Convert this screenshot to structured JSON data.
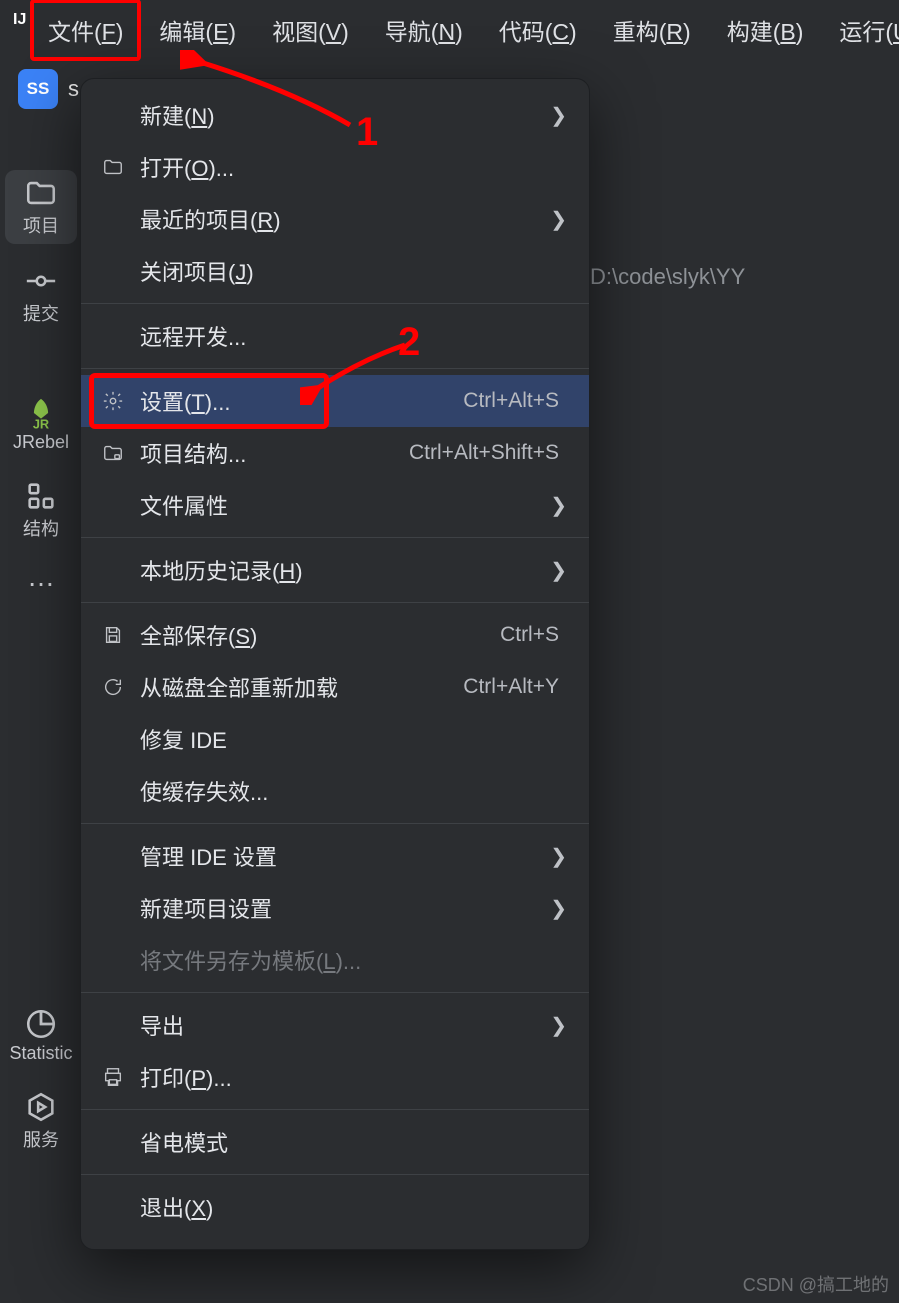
{
  "menubar": {
    "items": [
      {
        "pre": "文件(",
        "mn": "F",
        "post": ")"
      },
      {
        "pre": "编辑(",
        "mn": "E",
        "post": ")"
      },
      {
        "pre": "视图(",
        "mn": "V",
        "post": ")"
      },
      {
        "pre": "导航(",
        "mn": "N",
        "post": ")"
      },
      {
        "pre": "代码(",
        "mn": "C",
        "post": ")"
      },
      {
        "pre": "重构(",
        "mn": "R",
        "post": ")"
      },
      {
        "pre": "构建(",
        "mn": "B",
        "post": ")"
      },
      {
        "pre": "运行(",
        "mn": "U",
        "post": ""
      }
    ]
  },
  "breadcrumb": {
    "badge": "SS",
    "text": "s"
  },
  "leftbar": {
    "project": "项目",
    "commit": "提交",
    "jrebel": "JRebel",
    "structure": "结构",
    "statistic": "Statistic",
    "services": "服务"
  },
  "editorHint": "D:\\code\\slyk\\YY",
  "menu": {
    "new": {
      "pre": "新建(",
      "mn": "N",
      "post": ")"
    },
    "open": {
      "pre": "打开(",
      "mn": "O",
      "post": ")..."
    },
    "recent": {
      "pre": "最近的项目(",
      "mn": "R",
      "post": ")"
    },
    "close": {
      "pre": "关闭项目(",
      "mn": "J",
      "post": ")"
    },
    "remote": {
      "text": "远程开发..."
    },
    "settings": {
      "pre": "设置(",
      "mn": "T",
      "post": ")...",
      "shortcut": "Ctrl+Alt+S"
    },
    "structure": {
      "text": "项目结构...",
      "shortcut": "Ctrl+Alt+Shift+S"
    },
    "fileprops": {
      "text": "文件属性"
    },
    "history": {
      "pre": "本地历史记录(",
      "mn": "H",
      "post": ")"
    },
    "saveall": {
      "pre": "全部保存(",
      "mn": "S",
      "post": ")",
      "shortcut": "Ctrl+S"
    },
    "reload": {
      "text": "从磁盘全部重新加载",
      "shortcut": "Ctrl+Alt+Y"
    },
    "repair": {
      "text": "修复 IDE"
    },
    "invalidate": {
      "text": "使缓存失效..."
    },
    "manage": {
      "text": "管理 IDE 设置"
    },
    "newproj": {
      "text": "新建项目设置"
    },
    "template": {
      "pre": "将文件另存为模板(",
      "mn": "L",
      "post": ")..."
    },
    "export": {
      "text": "导出"
    },
    "print": {
      "pre": "打印(",
      "mn": "P",
      "post": ")..."
    },
    "power": {
      "text": "省电模式"
    },
    "exit": {
      "pre": "退出(",
      "mn": "X",
      "post": ")"
    }
  },
  "annotations": {
    "n1": "1",
    "n2": "2"
  },
  "watermark": "CSDN @搞工地的"
}
